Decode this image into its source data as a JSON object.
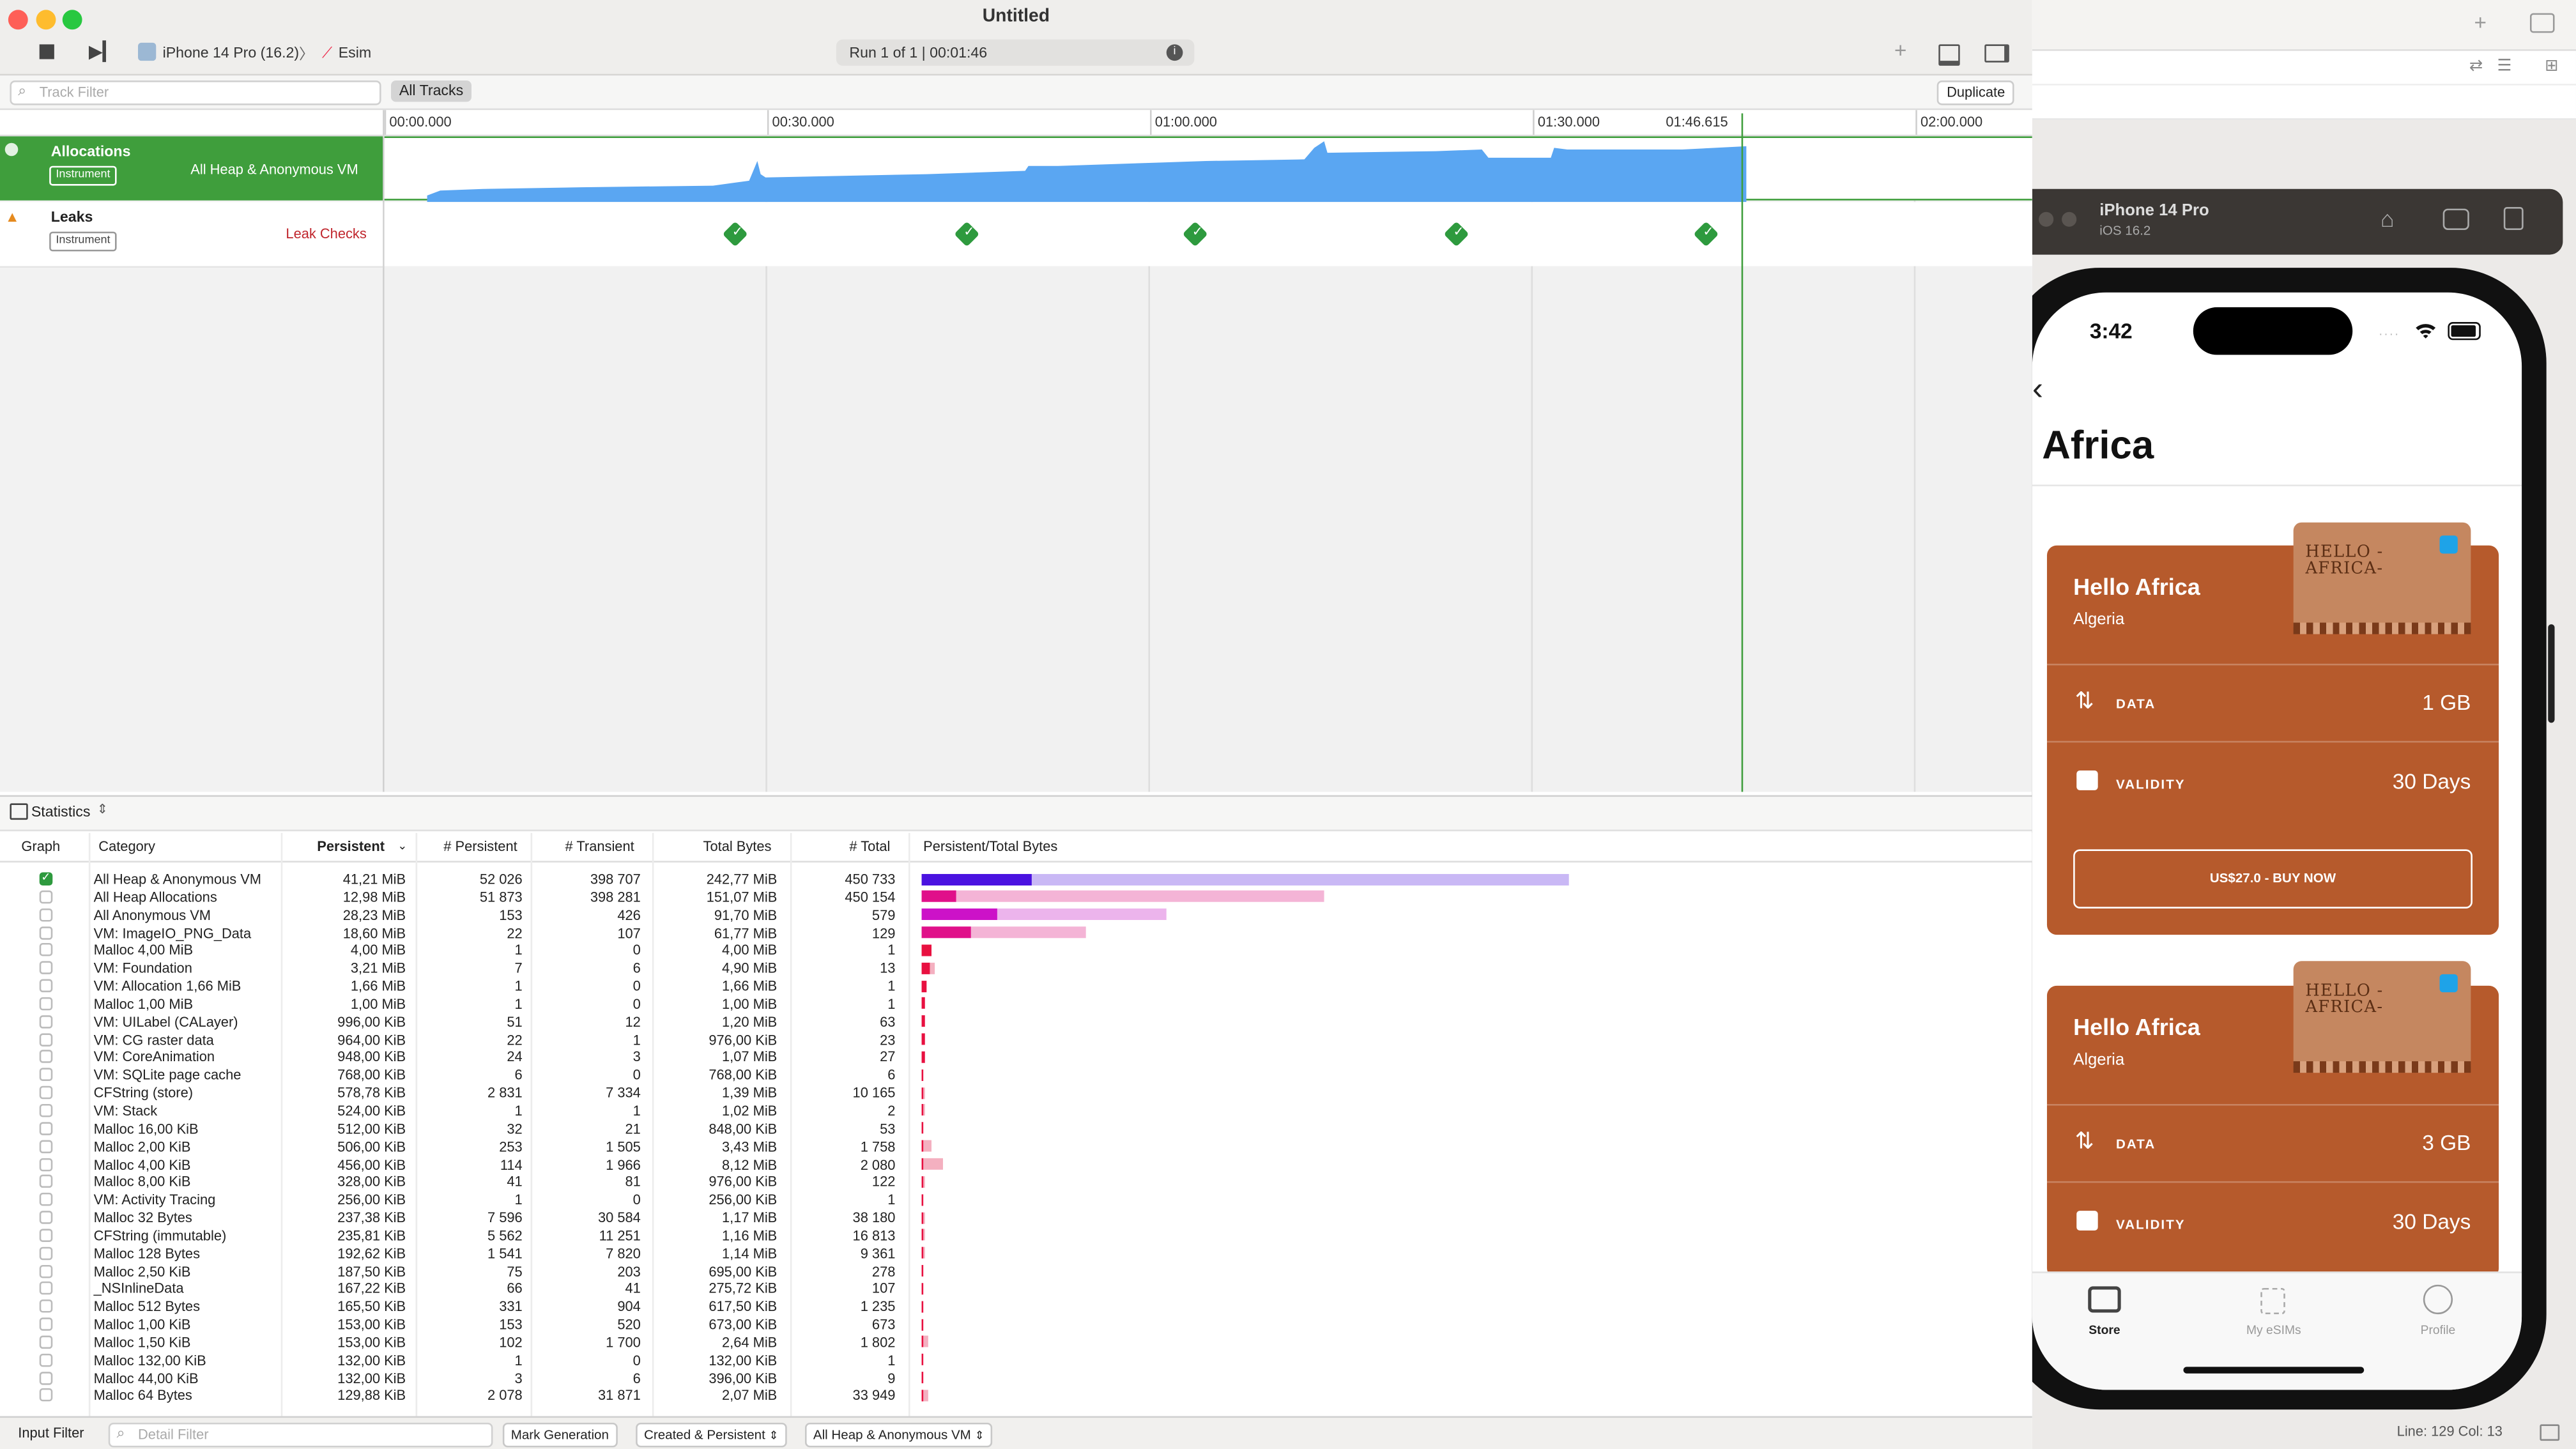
{
  "window": {
    "title": "Untitled"
  },
  "toolbar": {
    "device": "iPhone 14 Pro (16.2)",
    "separator": "〉",
    "target": "Esim",
    "run_status": "Run 1 of 1  |  00:01:46"
  },
  "filter_bar": {
    "track_filter_placeholder": "Track Filter",
    "all_tracks": "All Tracks",
    "duplicate": "Duplicate"
  },
  "timeline": {
    "ticks": [
      "00:00.000",
      "00:30.000",
      "01:00.000",
      "01:30.000",
      "01:46.615",
      "02:00.000"
    ]
  },
  "tracks": [
    {
      "name": "Allocations",
      "badge": "Instrument",
      "detail": "All Heap & Anonymous VM"
    },
    {
      "name": "Leaks",
      "badge": "Instrument",
      "detail": "Leak Checks"
    }
  ],
  "stats": {
    "view_label": "Statistics",
    "columns": [
      "Graph",
      "Category",
      "Persistent",
      "# Persistent",
      "# Transient",
      "Total Bytes",
      "# Total",
      "Persistent/Total Bytes"
    ],
    "rows": [
      {
        "checked": true,
        "category": "All Heap & Anonymous VM",
        "persistent": "41,21 MiB",
        "n_persistent": "52 026",
        "n_transient": "398 707",
        "total_bytes": "242,77 MiB",
        "n_total": "450 733",
        "p_frac": 0.17,
        "t_frac": 1.0,
        "p_color": "#4a12e0",
        "t_color": "#c9b8f5"
      },
      {
        "checked": false,
        "category": "All Heap Allocations",
        "persistent": "12,98 MiB",
        "n_persistent": "51 873",
        "n_transient": "398 281",
        "total_bytes": "151,07 MiB",
        "n_total": "450 154",
        "p_frac": 0.053,
        "t_frac": 0.622,
        "p_color": "#e0108a",
        "t_color": "#f4b4d6"
      },
      {
        "checked": false,
        "category": "All Anonymous VM",
        "persistent": "28,23 MiB",
        "n_persistent": "153",
        "n_transient": "426",
        "total_bytes": "91,70 MiB",
        "n_total": "579",
        "p_frac": 0.116,
        "t_frac": 0.378,
        "p_color": "#cc12c8",
        "t_color": "#ecb4ec"
      },
      {
        "checked": false,
        "category": "VM: ImageIO_PNG_Data",
        "persistent": "18,60 MiB",
        "n_persistent": "22",
        "n_transient": "107",
        "total_bytes": "61,77 MiB",
        "n_total": "129",
        "p_frac": 0.077,
        "t_frac": 0.254,
        "p_color": "#e0108a",
        "t_color": "#f4b4d6"
      },
      {
        "checked": false,
        "category": "Malloc 4,00 MiB",
        "persistent": "4,00 MiB",
        "n_persistent": "1",
        "n_transient": "0",
        "total_bytes": "4,00 MiB",
        "n_total": "1",
        "p_frac": 0.016,
        "t_frac": 0.016,
        "p_color": "#e81040",
        "t_color": "#f4b0c0"
      },
      {
        "checked": false,
        "category": "VM: Foundation",
        "persistent": "3,21 MiB",
        "n_persistent": "7",
        "n_transient": "6",
        "total_bytes": "4,90 MiB",
        "n_total": "13",
        "p_frac": 0.013,
        "t_frac": 0.02,
        "p_color": "#e81040",
        "t_color": "#f4b0c0"
      },
      {
        "checked": false,
        "category": "VM: Allocation 1,66 MiB",
        "persistent": "1,66 MiB",
        "n_persistent": "1",
        "n_transient": "0",
        "total_bytes": "1,66 MiB",
        "n_total": "1",
        "p_frac": 0.007,
        "t_frac": 0.007,
        "p_color": "#e81040",
        "t_color": "#f4b0c0"
      },
      {
        "checked": false,
        "category": "Malloc 1,00 MiB",
        "persistent": "1,00 MiB",
        "n_persistent": "1",
        "n_transient": "0",
        "total_bytes": "1,00 MiB",
        "n_total": "1",
        "p_frac": 0.004,
        "t_frac": 0.004,
        "p_color": "#e81040",
        "t_color": "#f4b0c0"
      },
      {
        "checked": false,
        "category": "VM: UILabel (CALayer)",
        "persistent": "996,00 KiB",
        "n_persistent": "51",
        "n_transient": "12",
        "total_bytes": "1,20 MiB",
        "n_total": "63",
        "p_frac": 0.004,
        "t_frac": 0.005,
        "p_color": "#e81040",
        "t_color": "#f4b0c0"
      },
      {
        "checked": false,
        "category": "VM: CG raster data",
        "persistent": "964,00 KiB",
        "n_persistent": "22",
        "n_transient": "1",
        "total_bytes": "976,00 KiB",
        "n_total": "23",
        "p_frac": 0.004,
        "t_frac": 0.004,
        "p_color": "#e81040",
        "t_color": "#f4b0c0"
      },
      {
        "checked": false,
        "category": "VM: CoreAnimation",
        "persistent": "948,00 KiB",
        "n_persistent": "24",
        "n_transient": "3",
        "total_bytes": "1,07 MiB",
        "n_total": "27",
        "p_frac": 0.004,
        "t_frac": 0.004,
        "p_color": "#e81040",
        "t_color": "#f4b0c0"
      },
      {
        "checked": false,
        "category": "VM: SQLite page cache",
        "persistent": "768,00 KiB",
        "n_persistent": "6",
        "n_transient": "0",
        "total_bytes": "768,00 KiB",
        "n_total": "6",
        "p_frac": 0.003,
        "t_frac": 0.003,
        "p_color": "#e81040",
        "t_color": "#f4b0c0"
      },
      {
        "checked": false,
        "category": "CFString (store)",
        "persistent": "578,78 KiB",
        "n_persistent": "2 831",
        "n_transient": "7 334",
        "total_bytes": "1,39 MiB",
        "n_total": "10 165",
        "p_frac": 0.002,
        "t_frac": 0.006,
        "p_color": "#e81040",
        "t_color": "#f4b0c0"
      },
      {
        "checked": false,
        "category": "VM: Stack",
        "persistent": "524,00 KiB",
        "n_persistent": "1",
        "n_transient": "1",
        "total_bytes": "1,02 MiB",
        "n_total": "2",
        "p_frac": 0.002,
        "t_frac": 0.004,
        "p_color": "#e81040",
        "t_color": "#f4b0c0"
      },
      {
        "checked": false,
        "category": "Malloc 16,00 KiB",
        "persistent": "512,00 KiB",
        "n_persistent": "32",
        "n_transient": "21",
        "total_bytes": "848,00 KiB",
        "n_total": "53",
        "p_frac": 0.002,
        "t_frac": 0.003,
        "p_color": "#e81040",
        "t_color": "#f4b0c0"
      },
      {
        "checked": false,
        "category": "Malloc 2,00 KiB",
        "persistent": "506,00 KiB",
        "n_persistent": "253",
        "n_transient": "1 505",
        "total_bytes": "3,43 MiB",
        "n_total": "1 758",
        "p_frac": 0.002,
        "t_frac": 0.014,
        "p_color": "#e81040",
        "t_color": "#f4b0c0"
      },
      {
        "checked": false,
        "category": "Malloc 4,00 KiB",
        "persistent": "456,00 KiB",
        "n_persistent": "114",
        "n_transient": "1 966",
        "total_bytes": "8,12 MiB",
        "n_total": "2 080",
        "p_frac": 0.002,
        "t_frac": 0.033,
        "p_color": "#e81040",
        "t_color": "#f4b0c0"
      },
      {
        "checked": false,
        "category": "Malloc 8,00 KiB",
        "persistent": "328,00 KiB",
        "n_persistent": "41",
        "n_transient": "81",
        "total_bytes": "976,00 KiB",
        "n_total": "122",
        "p_frac": 0.001,
        "t_frac": 0.004,
        "p_color": "#e81040",
        "t_color": "#f4b0c0"
      },
      {
        "checked": false,
        "category": "VM: Activity Tracing",
        "persistent": "256,00 KiB",
        "n_persistent": "1",
        "n_transient": "0",
        "total_bytes": "256,00 KiB",
        "n_total": "1",
        "p_frac": 0.001,
        "t_frac": 0.001,
        "p_color": "#e81040",
        "t_color": "#f4b0c0"
      },
      {
        "checked": false,
        "category": "Malloc 32 Bytes",
        "persistent": "237,38 KiB",
        "n_persistent": "7 596",
        "n_transient": "30 584",
        "total_bytes": "1,17 MiB",
        "n_total": "38 180",
        "p_frac": 0.001,
        "t_frac": 0.005,
        "p_color": "#e81040",
        "t_color": "#f4b0c0"
      },
      {
        "checked": false,
        "category": "CFString (immutable)",
        "persistent": "235,81 KiB",
        "n_persistent": "5 562",
        "n_transient": "11 251",
        "total_bytes": "1,16 MiB",
        "n_total": "16 813",
        "p_frac": 0.001,
        "t_frac": 0.005,
        "p_color": "#e81040",
        "t_color": "#f4b0c0"
      },
      {
        "checked": false,
        "category": "Malloc 128 Bytes",
        "persistent": "192,62 KiB",
        "n_persistent": "1 541",
        "n_transient": "7 820",
        "total_bytes": "1,14 MiB",
        "n_total": "9 361",
        "p_frac": 0.001,
        "t_frac": 0.005,
        "p_color": "#e81040",
        "t_color": "#f4b0c0"
      },
      {
        "checked": false,
        "category": "Malloc 2,50 KiB",
        "persistent": "187,50 KiB",
        "n_persistent": "75",
        "n_transient": "203",
        "total_bytes": "695,00 KiB",
        "n_total": "278",
        "p_frac": 0.001,
        "t_frac": 0.003,
        "p_color": "#e81040",
        "t_color": "#f4b0c0"
      },
      {
        "checked": false,
        "category": "_NSInlineData",
        "persistent": "167,22 KiB",
        "n_persistent": "66",
        "n_transient": "41",
        "total_bytes": "275,72 KiB",
        "n_total": "107",
        "p_frac": 0.001,
        "t_frac": 0.001,
        "p_color": "#e81040",
        "t_color": "#f4b0c0"
      },
      {
        "checked": false,
        "category": "Malloc 512 Bytes",
        "persistent": "165,50 KiB",
        "n_persistent": "331",
        "n_transient": "904",
        "total_bytes": "617,50 KiB",
        "n_total": "1 235",
        "p_frac": 0.001,
        "t_frac": 0.002,
        "p_color": "#e81040",
        "t_color": "#f4b0c0"
      },
      {
        "checked": false,
        "category": "Malloc 1,00 KiB",
        "persistent": "153,00 KiB",
        "n_persistent": "153",
        "n_transient": "520",
        "total_bytes": "673,00 KiB",
        "n_total": "673",
        "p_frac": 0.001,
        "t_frac": 0.003,
        "p_color": "#e81040",
        "t_color": "#f4b0c0"
      },
      {
        "checked": false,
        "category": "Malloc 1,50 KiB",
        "persistent": "153,00 KiB",
        "n_persistent": "102",
        "n_transient": "1 700",
        "total_bytes": "2,64 MiB",
        "n_total": "1 802",
        "p_frac": 0.001,
        "t_frac": 0.011,
        "p_color": "#e81040",
        "t_color": "#f4b0c0"
      },
      {
        "checked": false,
        "category": "Malloc 132,00 KiB",
        "persistent": "132,00 KiB",
        "n_persistent": "1",
        "n_transient": "0",
        "total_bytes": "132,00 KiB",
        "n_total": "1",
        "p_frac": 0.001,
        "t_frac": 0.001,
        "p_color": "#e81040",
        "t_color": "#f4b0c0"
      },
      {
        "checked": false,
        "category": "Malloc 44,00 KiB",
        "persistent": "132,00 KiB",
        "n_persistent": "3",
        "n_transient": "6",
        "total_bytes": "396,00 KiB",
        "n_total": "9",
        "p_frac": 0.001,
        "t_frac": 0.002,
        "p_color": "#e81040",
        "t_color": "#f4b0c0"
      },
      {
        "checked": false,
        "category": "Malloc 64 Bytes",
        "persistent": "129,88 KiB",
        "n_persistent": "2 078",
        "n_transient": "31 871",
        "total_bytes": "2,07 MiB",
        "n_total": "33 949",
        "p_frac": 0.001,
        "t_frac": 0.009,
        "p_color": "#e81040",
        "t_color": "#f4b0c0"
      }
    ]
  },
  "footer": {
    "input_filter": "Input Filter",
    "detail_filter_placeholder": "Detail Filter",
    "mark_generation": "Mark Generation",
    "lifespan": "Created & Persistent",
    "allocation_type": "All Heap & Anonymous VM"
  },
  "simulator": {
    "device_name": "iPhone 14 Pro",
    "os": "iOS 16.2",
    "time": "3:42",
    "screen_title": "Africa",
    "cards": [
      {
        "stamp_text": "HELLO -AFRICA-",
        "title": "Hello Africa",
        "country": "Algeria",
        "data_label": "DATA",
        "data_value": "1 GB",
        "validity_label": "VALIDITY",
        "validity_value": "30 Days",
        "buy_label": "US$27.0 - BUY NOW"
      },
      {
        "stamp_text": "HELLO -AFRICA-",
        "title": "Hello Africa",
        "country": "Algeria",
        "data_label": "DATA",
        "data_value": "3 GB",
        "validity_label": "VALIDITY",
        "validity_value": "30 Days"
      }
    ],
    "tabs": [
      {
        "label": "Store",
        "active": true
      },
      {
        "label": "My eSIMs",
        "active": false
      },
      {
        "label": "Profile",
        "active": false
      }
    ]
  },
  "status_bar": {
    "cursor": "Line: 129  Col: 13"
  },
  "colors": {
    "allocations_green": "#3f9e3c",
    "graph_blue": "#5aa6f2",
    "card_brown": "#b65a2c"
  }
}
